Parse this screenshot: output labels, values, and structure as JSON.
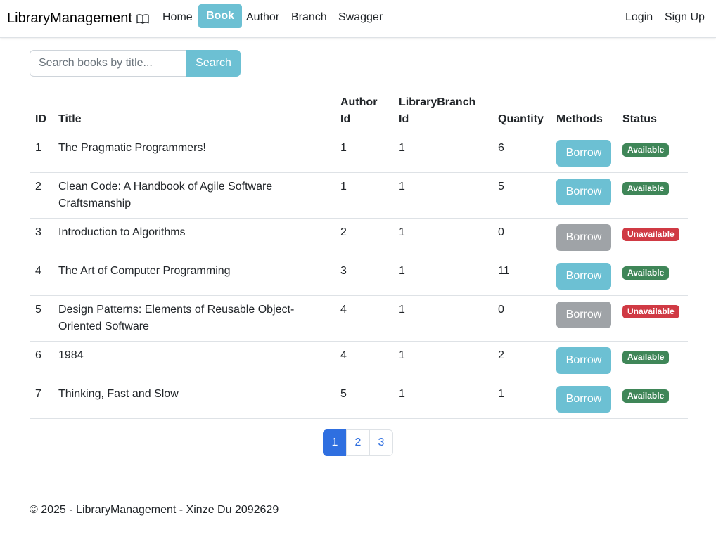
{
  "navbar": {
    "brand": "LibraryManagement",
    "links": [
      "Home",
      "Book",
      "Author",
      "Branch",
      "Swagger"
    ],
    "active": "Book",
    "auth": {
      "login": "Login",
      "signup": "Sign Up"
    }
  },
  "search": {
    "placeholder": "Search books by title...",
    "value": "",
    "button": "Search"
  },
  "table": {
    "headers": {
      "id": "ID",
      "title": "Title",
      "author_id_1": "Author",
      "author_id_2": "Id",
      "branch_id_1": "LibraryBranch",
      "branch_id_2": "Id",
      "quantity": "Quantity",
      "methods": "Methods",
      "status": "Status"
    },
    "rows": [
      {
        "id": "1",
        "title": "The Pragmatic Programmers!",
        "author_id": "1",
        "branch_id": "1",
        "quantity": "6",
        "action": "Borrow",
        "status": "Available"
      },
      {
        "id": "2",
        "title": "Clean Code: A Handbook of Agile Software Craftsmanship",
        "author_id": "1",
        "branch_id": "1",
        "quantity": "5",
        "action": "Borrow",
        "status": "Available"
      },
      {
        "id": "3",
        "title": "Introduction to Algorithms",
        "author_id": "2",
        "branch_id": "1",
        "quantity": "0",
        "action": "Borrow",
        "status": "Unavailable"
      },
      {
        "id": "4",
        "title": "The Art of Computer Programming",
        "author_id": "3",
        "branch_id": "1",
        "quantity": "11",
        "action": "Borrow",
        "status": "Available"
      },
      {
        "id": "5",
        "title": "Design Patterns: Elements of Reusable Object-Oriented Software",
        "author_id": "4",
        "branch_id": "1",
        "quantity": "0",
        "action": "Borrow",
        "status": "Unavailable"
      },
      {
        "id": "6",
        "title": "1984",
        "author_id": "4",
        "branch_id": "1",
        "quantity": "2",
        "action": "Borrow",
        "status": "Available"
      },
      {
        "id": "7",
        "title": "Thinking, Fast and Slow",
        "author_id": "5",
        "branch_id": "1",
        "quantity": "1",
        "action": "Borrow",
        "status": "Available"
      }
    ]
  },
  "pagination": {
    "pages": [
      "1",
      "2",
      "3"
    ],
    "current": "1"
  },
  "footer": "© 2025 - LibraryManagement - Xinze Du 2092629",
  "colors": {
    "info": "#6cc0d3",
    "available": "#3f8658",
    "unavailable": "#d03a44",
    "primary": "#2f6fe0",
    "disabled": "#9fa3a7"
  },
  "icons": {
    "brand_icon": "book-open-icon"
  }
}
